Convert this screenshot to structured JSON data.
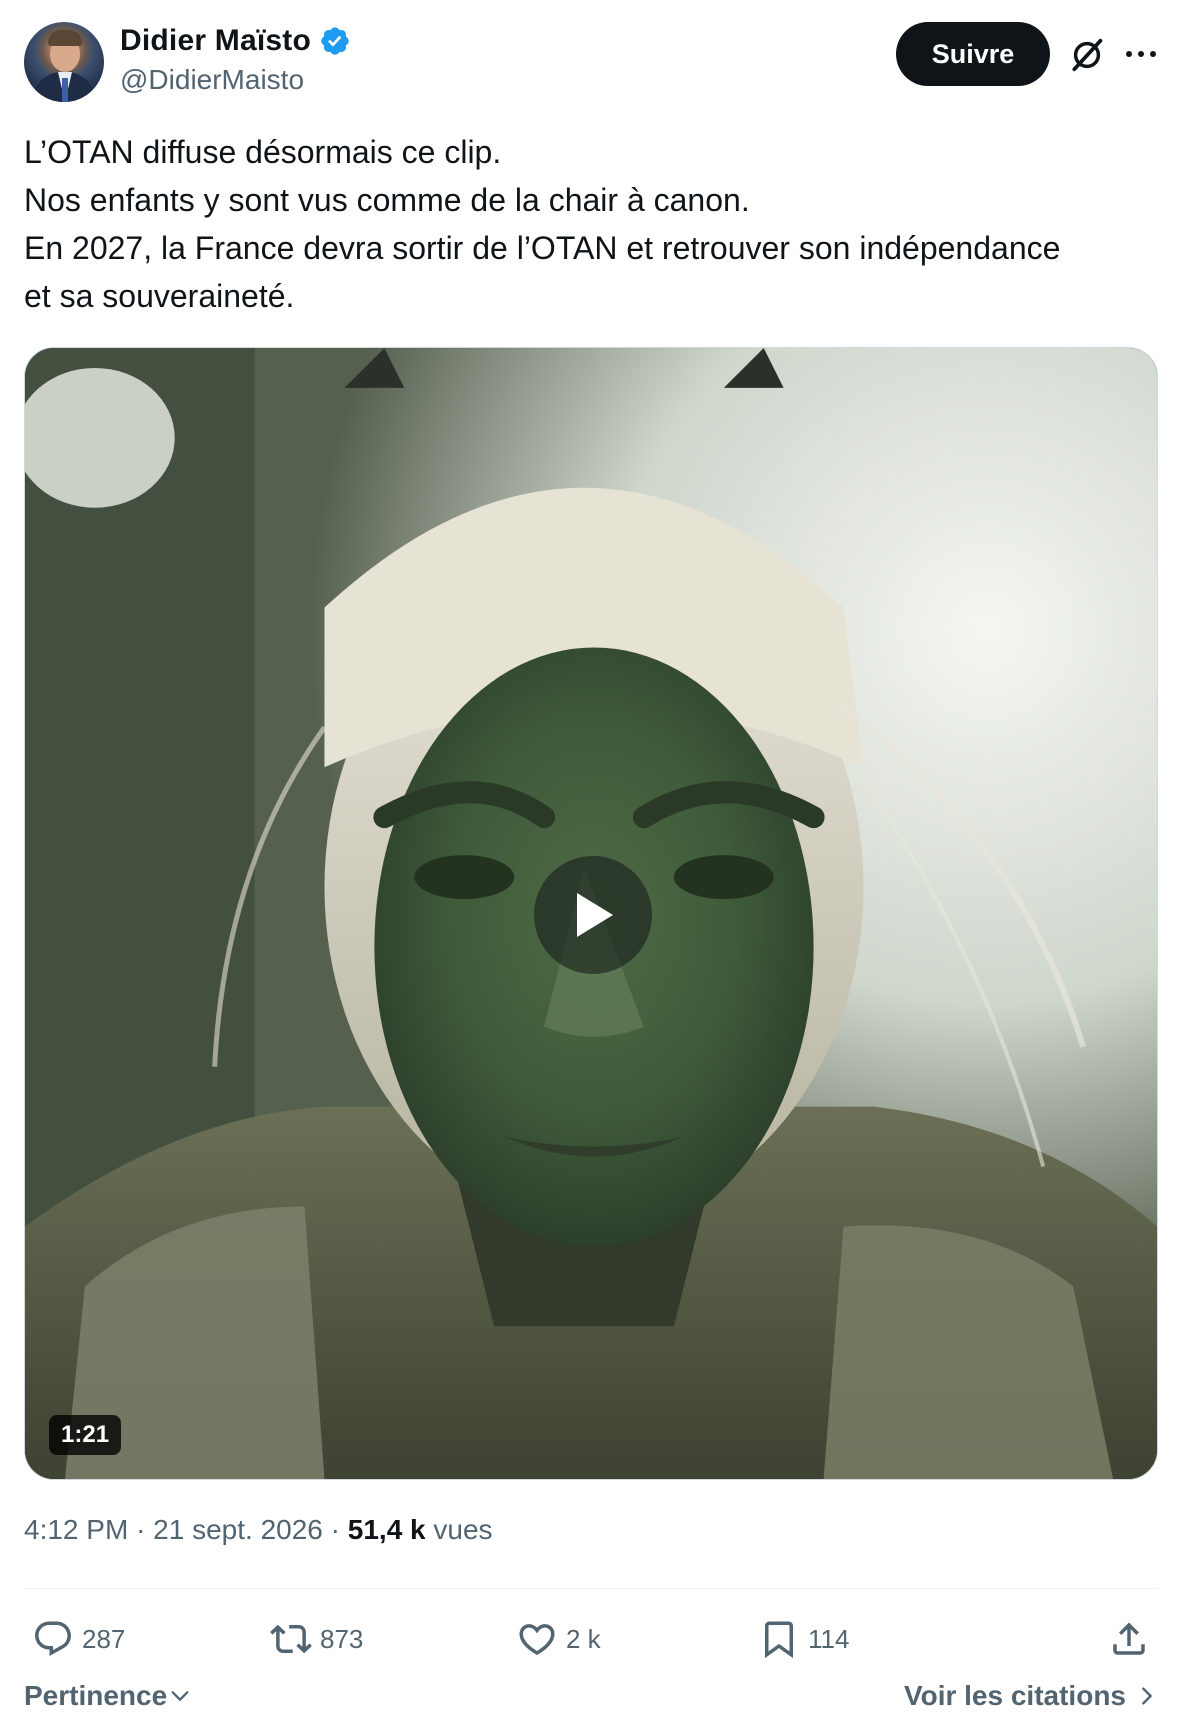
{
  "author": {
    "display_name": "Didier Maïsto",
    "handle": "@DidierMaisto",
    "verified": true
  },
  "header": {
    "follow_label": "Suivre"
  },
  "tweet": {
    "lines": [
      "L’OTAN diffuse désormais ce clip.",
      "Nos enfants y sont vus comme de la chair à canon.",
      "En 2027, la France devra sortir de l’OTAN et retrouver son indépendance",
      "et sa souveraineté."
    ]
  },
  "media": {
    "type": "video",
    "duration": "1:21"
  },
  "meta": {
    "time": "4:12 PM",
    "separator": "·",
    "date": "21 sept. 2026",
    "views_count": "51,4 k",
    "views_label": "vues"
  },
  "actions": {
    "replies": "287",
    "reposts": "873",
    "likes": "2 k",
    "bookmarks": "114"
  },
  "footer": {
    "sort_label": "Pertinence",
    "quotes_label": "Voir les citations"
  },
  "colors": {
    "text_primary": "#0f1419",
    "text_secondary": "#536471",
    "verified_blue": "#1d9bf0",
    "follow_bg": "#0f1419"
  },
  "icons": [
    "verified-badge-icon",
    "grok-icon",
    "more-icon",
    "play-icon",
    "reply-icon",
    "repost-icon",
    "like-icon",
    "bookmark-icon",
    "share-icon",
    "chevron-down-icon",
    "chevron-right-icon"
  ]
}
